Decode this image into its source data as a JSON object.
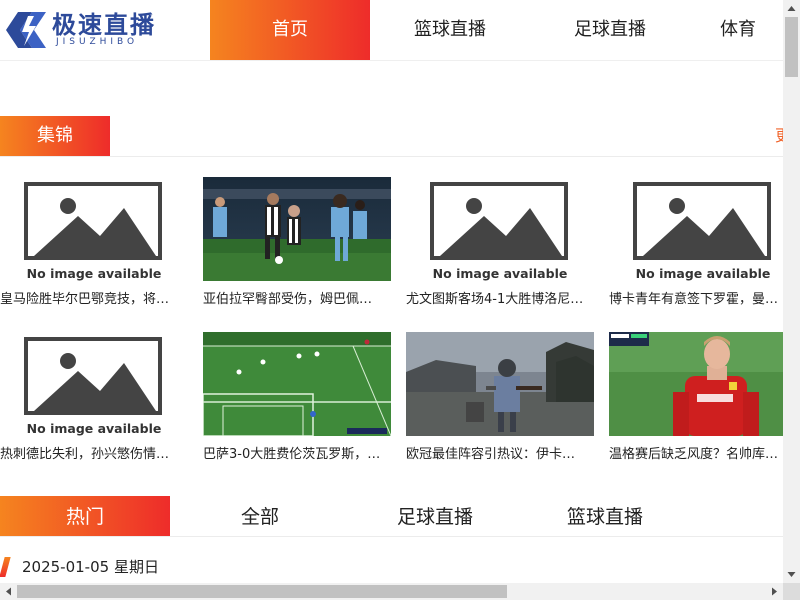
{
  "logo": {
    "name_cn": "极速直播",
    "name_en": "JISUZHIBO"
  },
  "nav": {
    "items": [
      {
        "label": "首页",
        "active": true
      },
      {
        "label": "篮球直播",
        "active": false
      },
      {
        "label": "足球直播",
        "active": false
      },
      {
        "label": "体育",
        "active": false
      }
    ]
  },
  "highlights": {
    "title": "集锦",
    "more_label": "更",
    "no_image_text": "No image available",
    "cards": [
      {
        "caption": "皇马险胜毕尔巴鄂竞技，将…",
        "image": "no-image"
      },
      {
        "caption": "亚伯拉罕臀部受伤，姆巴佩…",
        "image": "football-night-match"
      },
      {
        "caption": "尤文图斯客场4-1大胜博洛尼…",
        "image": "no-image"
      },
      {
        "caption": "博卡青年有意签下罗霍，曼…",
        "image": "no-image"
      },
      {
        "caption": "热刺德比失利，孙兴慜伤情…",
        "image": "no-image"
      },
      {
        "caption": "巴萨3-0大胜费伦茨瓦罗斯，…",
        "image": "football-pitch-wide"
      },
      {
        "caption": "欧冠最佳阵容引热议：伊卡…",
        "image": "game-warrior"
      },
      {
        "caption": "温格赛后缺乏风度？名帅库…",
        "image": "red-kit-player"
      }
    ]
  },
  "hot": {
    "tabs": [
      {
        "label": "热门",
        "active": true
      },
      {
        "label": "全部",
        "active": false
      },
      {
        "label": "足球直播",
        "active": false
      },
      {
        "label": "篮球直播",
        "active": false
      }
    ],
    "date_label": "2025-01-05  星期日"
  },
  "colors": {
    "accent_start": "#f5841f",
    "accent_end": "#ee2c2a",
    "logo_blue": "#2d4a9a"
  }
}
